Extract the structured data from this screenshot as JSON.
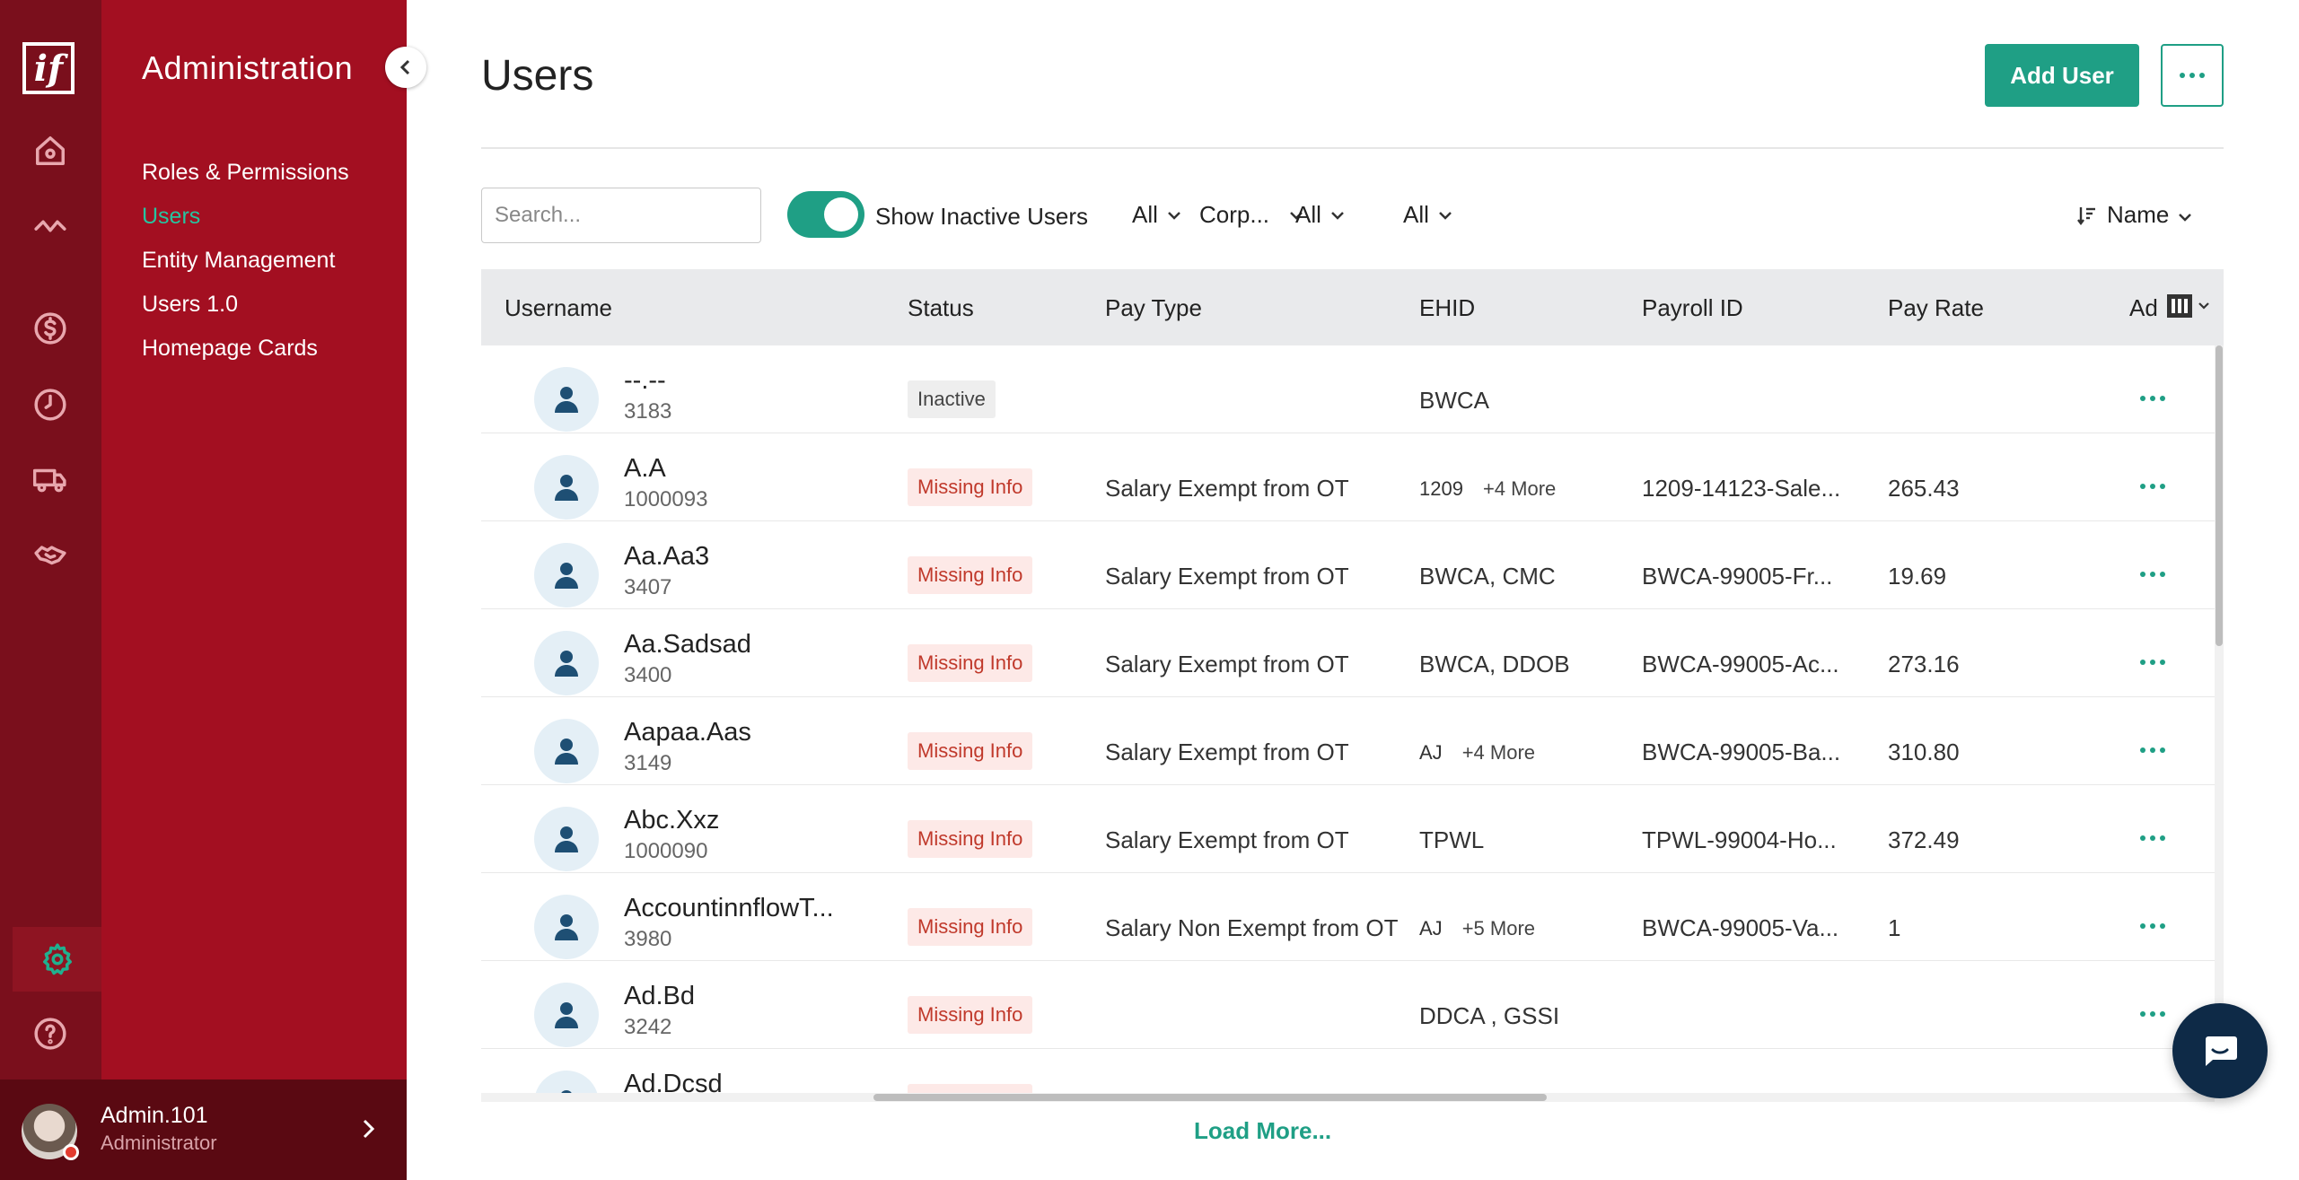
{
  "app": {
    "logo_text": "if"
  },
  "rail": {
    "icons": [
      "home-icon",
      "activity-icon",
      "dollar-icon",
      "clock-icon",
      "truck-icon",
      "handshake-icon",
      "settings-icon",
      "help-icon"
    ],
    "active": "settings-icon",
    "active_color": "#20b08f"
  },
  "sidebar": {
    "title": "Administration",
    "items": [
      {
        "label": "Roles & Permissions"
      },
      {
        "label": "Users"
      },
      {
        "label": "Entity Management"
      },
      {
        "label": "Users 1.0"
      },
      {
        "label": "Homepage Cards"
      }
    ],
    "active_index": 1,
    "bg_color": "#a30f21"
  },
  "user": {
    "name": "Admin.101",
    "role": "Administrator"
  },
  "page": {
    "title": "Users",
    "add_user_label": "Add User",
    "accent": "#1f9f85"
  },
  "filters": {
    "search_placeholder": "Search...",
    "search_value": "",
    "show_inactive_label": "Show Inactive Users",
    "show_inactive": true,
    "dropdowns": [
      "All",
      "Corp...",
      "All",
      "All"
    ],
    "sort_label": "Name"
  },
  "table": {
    "headers": [
      "Username",
      "Status",
      "Pay Type",
      "EHID",
      "Payroll ID",
      "Pay Rate",
      "Ad"
    ],
    "rows": [
      {
        "name": "--.--",
        "id": "3183",
        "status": "Inactive",
        "pay_type": "",
        "ehid": "BWCA",
        "ehid_more": "",
        "payroll_id": "",
        "pay_rate": ""
      },
      {
        "name": "A.A",
        "id": "1000093",
        "status": "Missing Info",
        "pay_type": "Salary Exempt from OT",
        "ehid": "1209",
        "ehid_more": "+4 More",
        "payroll_id": "1209-14123-Sale...",
        "pay_rate": "265.43"
      },
      {
        "name": "Aa.Aa3",
        "id": "3407",
        "status": "Missing Info",
        "pay_type": "Salary Exempt from OT",
        "ehid": "BWCA, CMC",
        "ehid_more": "",
        "payroll_id": "BWCA-99005-Fr...",
        "pay_rate": "19.69"
      },
      {
        "name": "Aa.Sadsad",
        "id": "3400",
        "status": "Missing Info",
        "pay_type": "Salary Exempt from OT",
        "ehid": "BWCA, DDOB",
        "ehid_more": "",
        "payroll_id": "BWCA-99005-Ac...",
        "pay_rate": "273.16"
      },
      {
        "name": "Aapaa.Aas",
        "id": "3149",
        "status": "Missing Info",
        "pay_type": "Salary Exempt from OT",
        "ehid": "AJ",
        "ehid_more": "+4 More",
        "payroll_id": "BWCA-99005-Ba...",
        "pay_rate": "310.80"
      },
      {
        "name": "Abc.Xxz",
        "id": "1000090",
        "status": "Missing Info",
        "pay_type": "Salary Exempt from OT",
        "ehid": "TPWL",
        "ehid_more": "",
        "payroll_id": "TPWL-99004-Ho...",
        "pay_rate": "372.49"
      },
      {
        "name": "AccountinnflowT...",
        "id": "3980",
        "status": "Missing Info",
        "pay_type": "Salary Non Exempt from OT",
        "ehid": "AJ",
        "ehid_more": "+5 More",
        "payroll_id": "BWCA-99005-Va...",
        "pay_rate": "1"
      },
      {
        "name": "Ad.Bd",
        "id": "3242",
        "status": "Missing Info",
        "pay_type": "",
        "ehid": "DDCA , GSSI",
        "ehid_more": "",
        "payroll_id": "",
        "pay_rate": ""
      },
      {
        "name": "Ad.Dcsd",
        "id": "",
        "status": "Missing Info",
        "pay_type": "",
        "ehid": "",
        "ehid_more": "",
        "payroll_id": "",
        "pay_rate": ""
      }
    ]
  },
  "footer": {
    "load_more": "Load More..."
  }
}
